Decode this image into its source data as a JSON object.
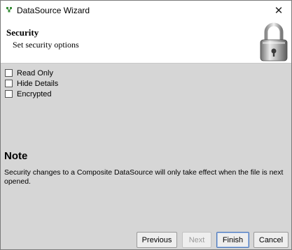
{
  "window": {
    "title": "DataSource Wizard",
    "close_glyph": "✕"
  },
  "header": {
    "title": "Security",
    "subtitle": "Set security options",
    "image": "padlock"
  },
  "options": [
    {
      "label": "Read Only",
      "checked": false
    },
    {
      "label": "Hide Details",
      "checked": false
    },
    {
      "label": "Encrypted",
      "checked": false
    }
  ],
  "note": {
    "title": "Note",
    "text": "Security changes to a Composite DataSource will only take effect when the file is next opened."
  },
  "buttons": {
    "previous": "Previous",
    "next": "Next",
    "finish": "Finish",
    "cancel": "Cancel"
  },
  "colors": {
    "panel_background": "#d6d6d6",
    "header_background": "#ffffff",
    "default_button_border": "#4b76b8"
  }
}
